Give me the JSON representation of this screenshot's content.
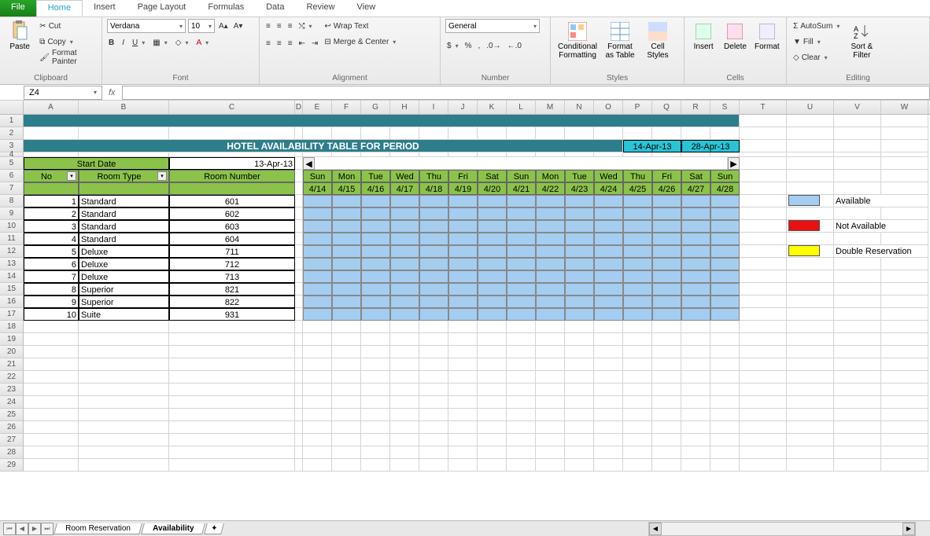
{
  "tabs": {
    "file": "File",
    "home": "Home",
    "insert": "Insert",
    "pagelayout": "Page Layout",
    "formulas": "Formulas",
    "data": "Data",
    "review": "Review",
    "view": "View"
  },
  "ribbon": {
    "clipboard": {
      "paste": "Paste",
      "cut": "Cut",
      "copy": "Copy",
      "fmtpainter": "Format Painter",
      "label": "Clipboard"
    },
    "font": {
      "name": "Verdana",
      "size": "10",
      "label": "Font"
    },
    "alignment": {
      "wrap": "Wrap Text",
      "merge": "Merge & Center",
      "label": "Alignment"
    },
    "number": {
      "format": "General",
      "label": "Number"
    },
    "styles": {
      "cond": "Conditional Formatting",
      "fmttable": "Format as Table",
      "cellstyles": "Cell Styles",
      "label": "Styles"
    },
    "cells": {
      "insert": "Insert",
      "delete": "Delete",
      "format": "Format",
      "label": "Cells"
    },
    "editing": {
      "autosum": "AutoSum",
      "fill": "Fill",
      "clear": "Clear",
      "sortfilter": "Sort & Filter",
      "label": "Editing"
    }
  },
  "namebox": "Z4",
  "colwidths": {
    "A": 70,
    "B": 115,
    "C": 160,
    "narrow": 37,
    "wide": 60
  },
  "colletters": [
    "A",
    "B",
    "C",
    "D",
    "E",
    "F",
    "G",
    "H",
    "I",
    "J",
    "K",
    "L",
    "M",
    "N",
    "O",
    "P",
    "Q",
    "R",
    "S",
    "T",
    "U",
    "V",
    "W"
  ],
  "title": "HOTEL AVAILABILITY TABLE FOR PERIOD",
  "period_from": "14-Apr-13",
  "period_to": "28-Apr-13",
  "start_date_label": "Start Date",
  "start_date": "13-Apr-13",
  "headers": {
    "no": "No",
    "roomtype": "Room Type",
    "roomnum": "Room Number"
  },
  "days": [
    {
      "d": "Sun",
      "dt": "4/14"
    },
    {
      "d": "Mon",
      "dt": "4/15"
    },
    {
      "d": "Tue",
      "dt": "4/16"
    },
    {
      "d": "Wed",
      "dt": "4/17"
    },
    {
      "d": "Thu",
      "dt": "4/18"
    },
    {
      "d": "Fri",
      "dt": "4/19"
    },
    {
      "d": "Sat",
      "dt": "4/20"
    },
    {
      "d": "Sun",
      "dt": "4/21"
    },
    {
      "d": "Mon",
      "dt": "4/22"
    },
    {
      "d": "Tue",
      "dt": "4/23"
    },
    {
      "d": "Wed",
      "dt": "4/24"
    },
    {
      "d": "Thu",
      "dt": "4/25"
    },
    {
      "d": "Fri",
      "dt": "4/26"
    },
    {
      "d": "Sat",
      "dt": "4/27"
    },
    {
      "d": "Sun",
      "dt": "4/28"
    }
  ],
  "rows": [
    {
      "no": "1",
      "type": "Standard",
      "num": "601"
    },
    {
      "no": "2",
      "type": "Standard",
      "num": "602"
    },
    {
      "no": "3",
      "type": "Standard",
      "num": "603"
    },
    {
      "no": "4",
      "type": "Standard",
      "num": "604"
    },
    {
      "no": "5",
      "type": "Deluxe",
      "num": "711"
    },
    {
      "no": "6",
      "type": "Deluxe",
      "num": "712"
    },
    {
      "no": "7",
      "type": "Deluxe",
      "num": "713"
    },
    {
      "no": "8",
      "type": "Superior",
      "num": "821"
    },
    {
      "no": "9",
      "type": "Superior",
      "num": "822"
    },
    {
      "no": "10",
      "type": "Suite",
      "num": "931"
    }
  ],
  "legend": {
    "avail": "Available",
    "notavail": "Not Available",
    "double": "Double Reservation"
  },
  "sheets": {
    "s1": "Room Reservation",
    "s2": "Availability"
  }
}
